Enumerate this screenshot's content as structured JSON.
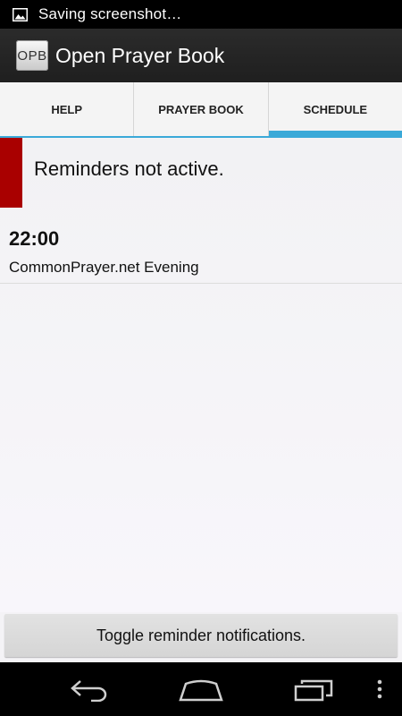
{
  "status_bar": {
    "notification_text": "Saving screenshot…",
    "icon": "image-icon"
  },
  "action_bar": {
    "app_icon_text": "OPB",
    "title": "Open Prayer Book"
  },
  "tabs": [
    {
      "label": "HELP",
      "active": false
    },
    {
      "label": "PRAYER BOOK",
      "active": false
    },
    {
      "label": "SCHEDULE",
      "active": true
    }
  ],
  "reminder_status": {
    "text": "Reminders not active.",
    "indicator_color": "#a90000"
  },
  "schedule": [
    {
      "time": "22:00",
      "name": "CommonPrayer.net Evening"
    }
  ],
  "toggle_button": {
    "label": "Toggle reminder notifications."
  },
  "nav_bar": {
    "icons": [
      "back-icon",
      "home-icon",
      "recent-apps-icon",
      "overflow-menu-icon"
    ]
  },
  "colors": {
    "accent": "#3aa9d8",
    "action_bar": "#222222",
    "inactive_indicator": "#a90000"
  }
}
